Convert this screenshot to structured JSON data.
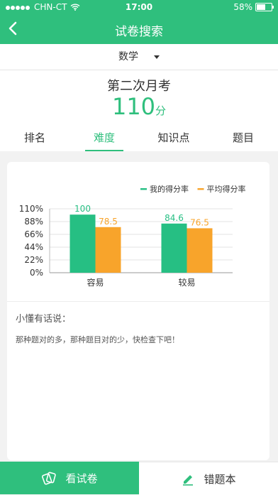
{
  "status_bar": {
    "carrier": "CHN-CT",
    "time": "17:00",
    "battery": "58%"
  },
  "nav": {
    "title": "试卷搜索"
  },
  "subject": {
    "selected": "数学"
  },
  "exam": {
    "name": "第二次月考",
    "score": "110",
    "score_unit": "分"
  },
  "tabs": [
    {
      "label": "排名"
    },
    {
      "label": "难度"
    },
    {
      "label": "知识点"
    },
    {
      "label": "题目"
    }
  ],
  "chart_data": {
    "type": "bar",
    "categories": [
      "容易",
      "较易"
    ],
    "series": [
      {
        "name": "我的得分率",
        "values": [
          100,
          84.6
        ],
        "color": "#26bf83"
      },
      {
        "name": "平均得分率",
        "values": [
          78.5,
          76.5
        ],
        "color": "#f8a42b"
      }
    ],
    "yticks": [
      "0%",
      "22%",
      "44%",
      "66%",
      "88%",
      "110%"
    ],
    "ylim": [
      0,
      110
    ],
    "legend": "top-right",
    "grid": true
  },
  "tip": {
    "title": "小懂有话说：",
    "body": "那种题对的多，那种题目对的少，快检查下吧！"
  },
  "bottom": {
    "left_label": "看试卷",
    "right_label": "错题本"
  },
  "colors": {
    "accent": "#2fbf7d"
  }
}
